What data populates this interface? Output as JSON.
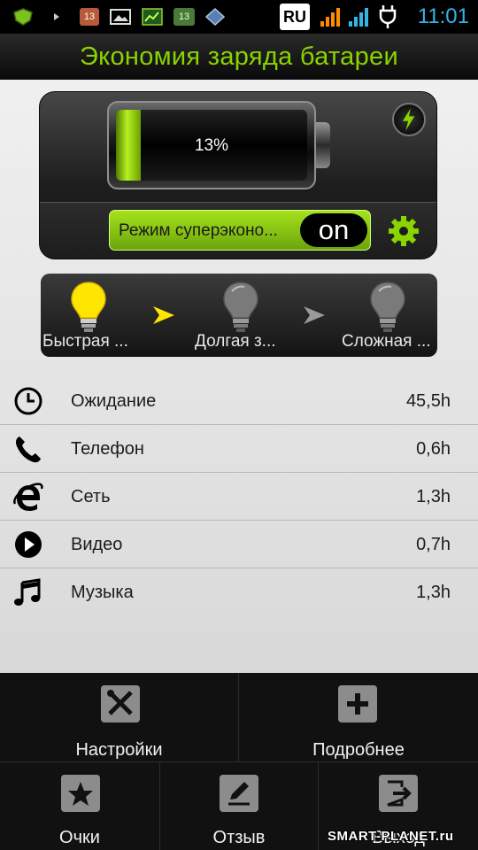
{
  "status_bar": {
    "notification_badge_1": "13",
    "notification_badge_2": "13",
    "language": "RU",
    "time": "11:01"
  },
  "title": "Экономия заряда батареи",
  "battery": {
    "percent_label": "13%",
    "level": 0.13,
    "fill_color": "#8ad400"
  },
  "super_save": {
    "label": "Режим суперэконо...",
    "state": "on"
  },
  "modes": [
    {
      "label": "Быстрая ...",
      "active": true
    },
    {
      "label": "Долгая з...",
      "active": false
    },
    {
      "label": "Сложная ...",
      "active": false
    }
  ],
  "usage": [
    {
      "icon": "clock-icon",
      "label": "Ожидание",
      "value": "45,5h"
    },
    {
      "icon": "phone-icon",
      "label": "Телефон",
      "value": "0,6h"
    },
    {
      "icon": "internet-explorer-icon",
      "label": "Сеть",
      "value": "1,3h"
    },
    {
      "icon": "play-icon",
      "label": "Видео",
      "value": "0,7h"
    },
    {
      "icon": "music-note-icon",
      "label": "Музыка",
      "value": "1,3h"
    }
  ],
  "menu": {
    "settings": "Настройки",
    "details": "Подробнее",
    "points": "Очки",
    "feedback": "Отзыв",
    "exit": "Выход"
  },
  "watermark": "SMART-PLANET.ru",
  "colors": {
    "accent_green": "#8ad400",
    "time_blue": "#33b5e5",
    "bulb_yellow": "#ffe600"
  }
}
